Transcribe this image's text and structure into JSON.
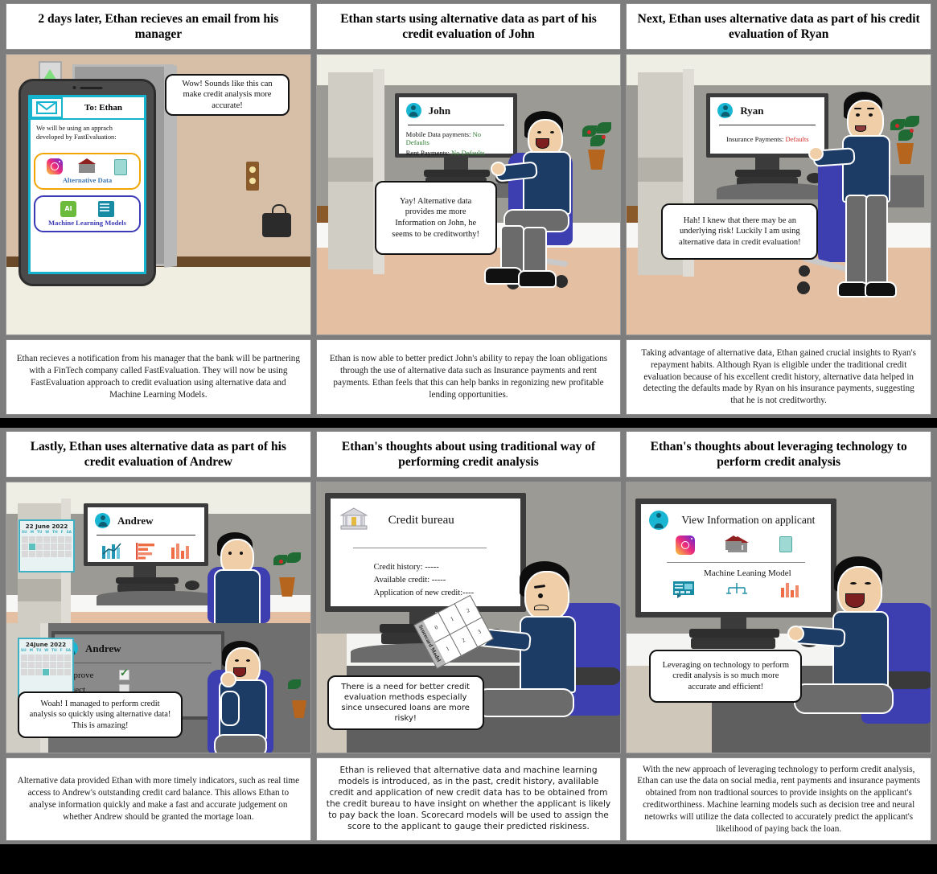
{
  "board": {
    "rows": [
      {
        "panels": [
          {
            "id": "p1",
            "title": "2 days later, Ethan recieves an email from his manager",
            "caption": "Ethan recieves a notification from his manager that the bank will be partnering with a FinTech company called FastEvaluation. They will now be using FastEvaluation approach to credit evaluation using alternative data and Machine Learning Models.",
            "bubble": "Wow! Sounds like this can make credit analysis more accurate!",
            "email": {
              "to": "To: Ethan",
              "body": "We will be using an apprach developed by FastEvaluation:",
              "option1_label": "Alternative Data",
              "option1_icons": [
                "instagram-icon",
                "house-icon",
                "document-icon"
              ],
              "option2_label": "Machine Learning Models",
              "option2_icons": [
                "ai-chip-icon",
                "ml-dashboard-icon"
              ],
              "mail_icon": "envelope-icon"
            }
          },
          {
            "id": "p2",
            "title": "Ethan starts using alternative data as part of his credit evaluation of John",
            "caption": "Ethan is now able to better predict John's ability to repay the loan obligations through the use of alternative data such as Insurance payments and rent payments. Ethan feels that this can help banks in regonizing new profitable lending opportunities.",
            "bubble": "Yay! Alternative data provides me more Information on John, he seems to be creditworthy!",
            "screen": {
              "name": "John",
              "rows": [
                {
                  "label": "Mobile Data payments:",
                  "value": "No Defaults",
                  "status": "ok"
                },
                {
                  "label": "Rent Payments:",
                  "value": "No Defaults",
                  "status": "ok"
                }
              ]
            }
          },
          {
            "id": "p3",
            "title": "Next, Ethan uses alternative data as part of his credit evaluation of Ryan",
            "caption": "Taking advantage of alternative data, Ethan gained crucial insights to Ryan's repayment habits. Although Ryan is eligible under the traditional credit evaluation because of his excellent credit history, alternative data helped in detecting the defaults made by Ryan on his insurance payments, suggesting that he is not creditworthy.",
            "bubble": "Hah! I knew that there may be an underlying risk! Luckily I am using alternative data in credit evaluation!",
            "screen": {
              "name": "Ryan",
              "rows": [
                {
                  "label": "Insurance Payments:",
                  "value": "Defaults",
                  "status": "bad"
                }
              ]
            }
          }
        ]
      },
      {
        "panels": [
          {
            "id": "p4",
            "title": "Lastly, Ethan uses alternative data as part of his credit evaluation of Andrew",
            "caption": "Alternative data provided Ethan with more timely indicators, such as real time access to Andrew's outstanding credit card balance. This allows Ethan to analyse information quickly and make a fast and accurate judgement on whether Andrew should be granted the mortage loan.",
            "bubble": "Woah! I managed to perform credit analysis so quickly using alternative data! This is amazing!",
            "screen_top": {
              "name": "Andrew",
              "icons": [
                "line-chart-icon",
                "bar-chart-horizontal-icon",
                "bar-chart-icon"
              ]
            },
            "screen_bottom": {
              "name": "Andrew",
              "approve_label": "Approve",
              "reject_label": "Reject",
              "approve_checked": true,
              "reject_checked": false
            },
            "calendar_top": {
              "title": "22 June 2022",
              "dow": [
                "SU",
                "M",
                "TU",
                "W",
                "TH",
                "F",
                "SA"
              ],
              "selected_index": 8
            },
            "calendar_bottom": {
              "title": "24June 2022",
              "dow": [
                "SU",
                "M",
                "TU",
                "W",
                "TH",
                "F",
                "SA"
              ],
              "selected_index": 17
            }
          },
          {
            "id": "p5",
            "title": "Ethan's thoughts about using traditional way of performing credit analysis",
            "caption": "Ethan is relieved that alternative data and machine learning models is introduced, as in the past, credit history, avalilable credit and application of new credit data has to be obtained from the credit bureau to have insight on whether the applicant is likely to pay back the loan. Scorecard models will be used to assign the score to the applicant to gauge their predicted riskiness.",
            "caption_font": "sans",
            "bubble": "There is a need for better credit evaluation methods especially since unsecured loans are more risky!",
            "bubble_font": "sans",
            "screen": {
              "title": "Credit bureau",
              "icon": "bank-icon",
              "lines": [
                "Credit history: -----",
                "Available credit: -----",
                "Application of new credit:----"
              ]
            },
            "scorecard": {
              "label": "Scorecard Model",
              "cells": [
                "0",
                "1",
                "2",
                "1",
                "2",
                "3"
              ]
            }
          },
          {
            "id": "p6",
            "title": "Ethan's thoughts about leveraging technology to perform credit analysis",
            "caption": "With the new approach of leveraging technology to perform credit analysis, Ethan can use the data on social media, rent payments and insurance payments obtained from non tradtional sources to provide insights on the applicant's creditworthiness. Machine learning models such as decision tree and neural netowrks will utilize the data collected to accurately predict the applicant's likelihood of paying back the loan.",
            "bubble": "Leveraging on technology to perform credit analysis is so much more accurate and efficient!",
            "screen": {
              "title": "View Information on applicant",
              "top_icons": [
                "instagram-icon",
                "house-icon",
                "document-icon"
              ],
              "section_title": "Machine Leaning Model",
              "bottom_icons": [
                "ml-dashboard-icon",
                "decision-tree-icon",
                "bar-chart-icon"
              ],
              "avatar": "user-avatar-icon"
            }
          }
        ]
      }
    ]
  },
  "colors": {
    "page_background": "#000000",
    "gutter": "#7d7d7d",
    "panel_background": "#ffffff",
    "accent_cyan": "#16b3cf",
    "accent_orange": "#f0a500",
    "accent_purple": "#3b3bb5",
    "status_ok": "#2e7d32",
    "status_bad": "#d32f2f",
    "shirt": "#1c3c66",
    "chair": "#3d3fb0"
  }
}
